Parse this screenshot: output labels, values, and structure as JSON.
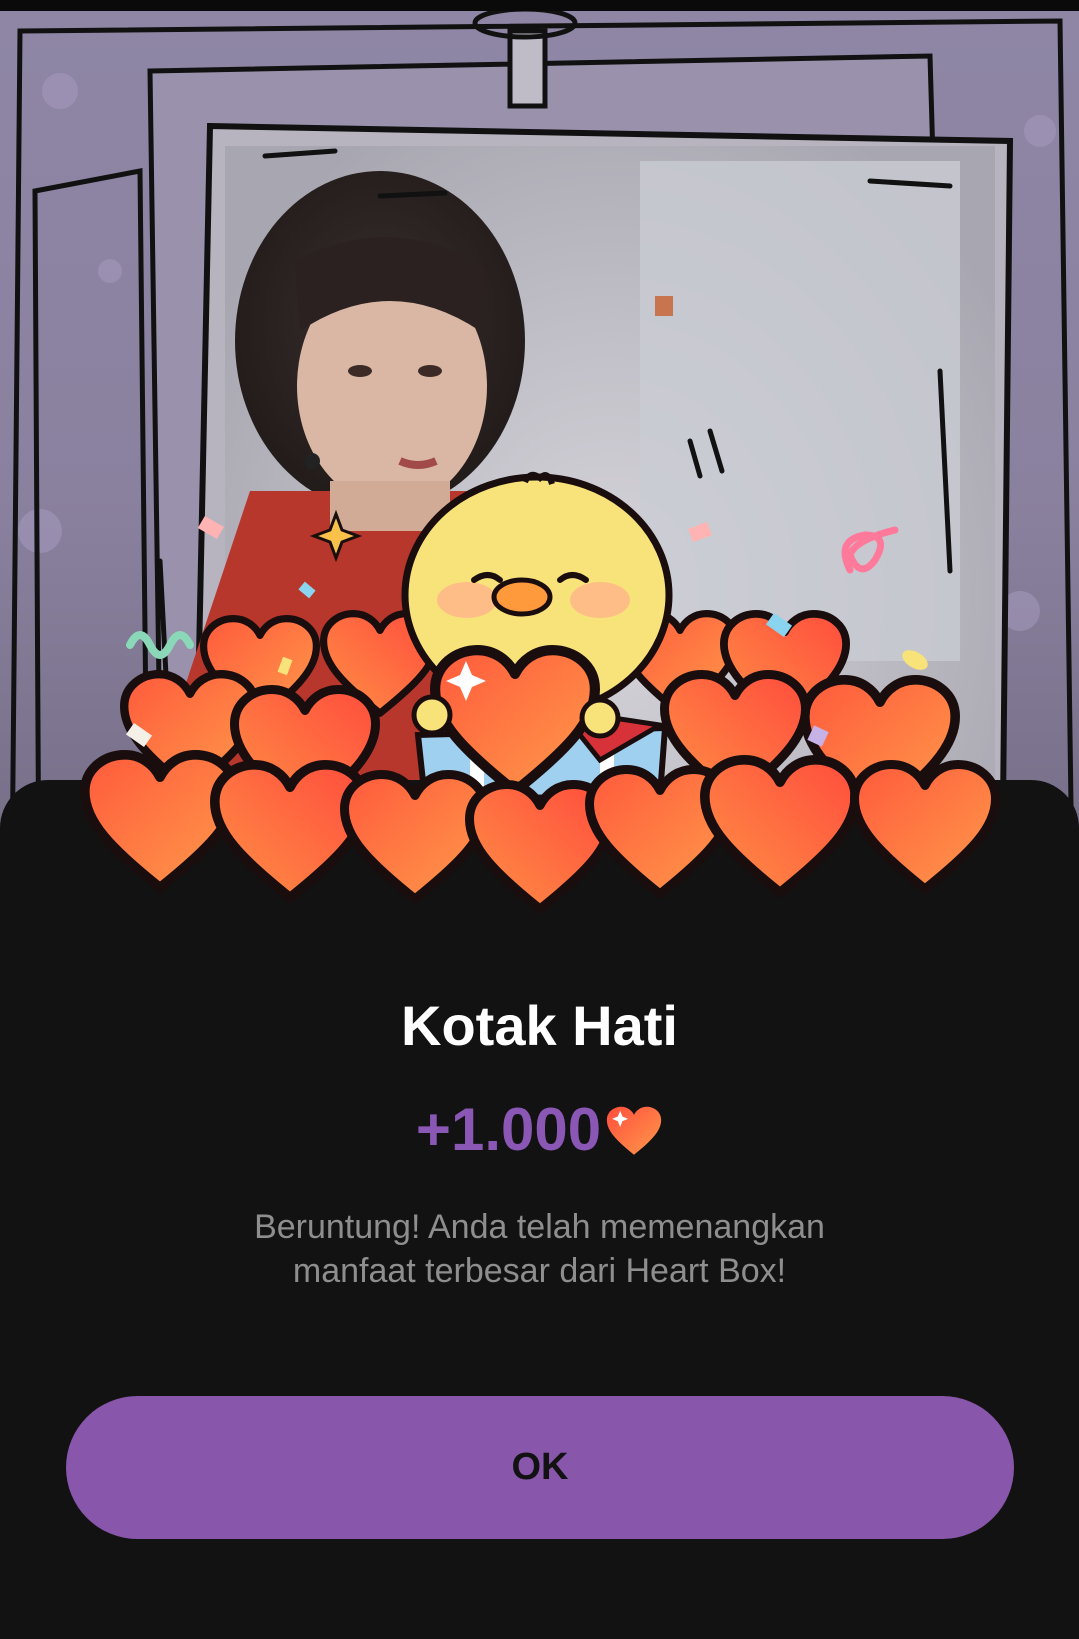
{
  "dialog": {
    "title": "Kotak Hati",
    "amount": "+1.000",
    "description": "Beruntung! Anda telah memenangkan\nmanfaat terbesar dari Heart Box!",
    "ok_label": "OK"
  },
  "icons": {
    "amount": "heart-icon",
    "illustration": "heart-box-mascot-icon"
  },
  "colors": {
    "accent": "#8856aa",
    "amount_text": "#8a57b5",
    "sheet_background": "#121212",
    "title_text": "#ffffff",
    "description_text": "#8e8e8e"
  }
}
